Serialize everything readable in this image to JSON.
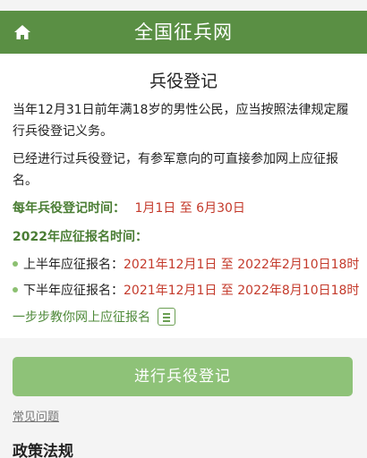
{
  "header": {
    "title": "全国征兵网",
    "home_icon": "home-icon",
    "color": "#5a8f44"
  },
  "page": {
    "title": "兵役登记",
    "paragraph1": "当年12月31日前年满18岁的男性公民，应当按照法律规定履行兵役登记义务。",
    "paragraph2": "已经进行过兵役登记，有参军意向的可直接参加网上应征报名。"
  },
  "registration": {
    "label": "每年兵役登记时间：",
    "value": "1月1日 至 6月30日"
  },
  "enlistment": {
    "label": "2022年应征报名时间：",
    "first_half": {
      "label": "上半年应征报名：",
      "value": "2021年12月1日 至 2022年2月10日18时"
    },
    "second_half": {
      "label": "下半年应征报名：",
      "value": "2021年12月1日 至 2022年8月10日18时"
    }
  },
  "guide": {
    "text": "一步步教你网上应征报名",
    "icon": "list-icon"
  },
  "button": {
    "label": "进行兵役登记",
    "color": "#8ec278"
  },
  "faq": {
    "label": "常见问题"
  },
  "policy": {
    "title": "政策法规"
  }
}
